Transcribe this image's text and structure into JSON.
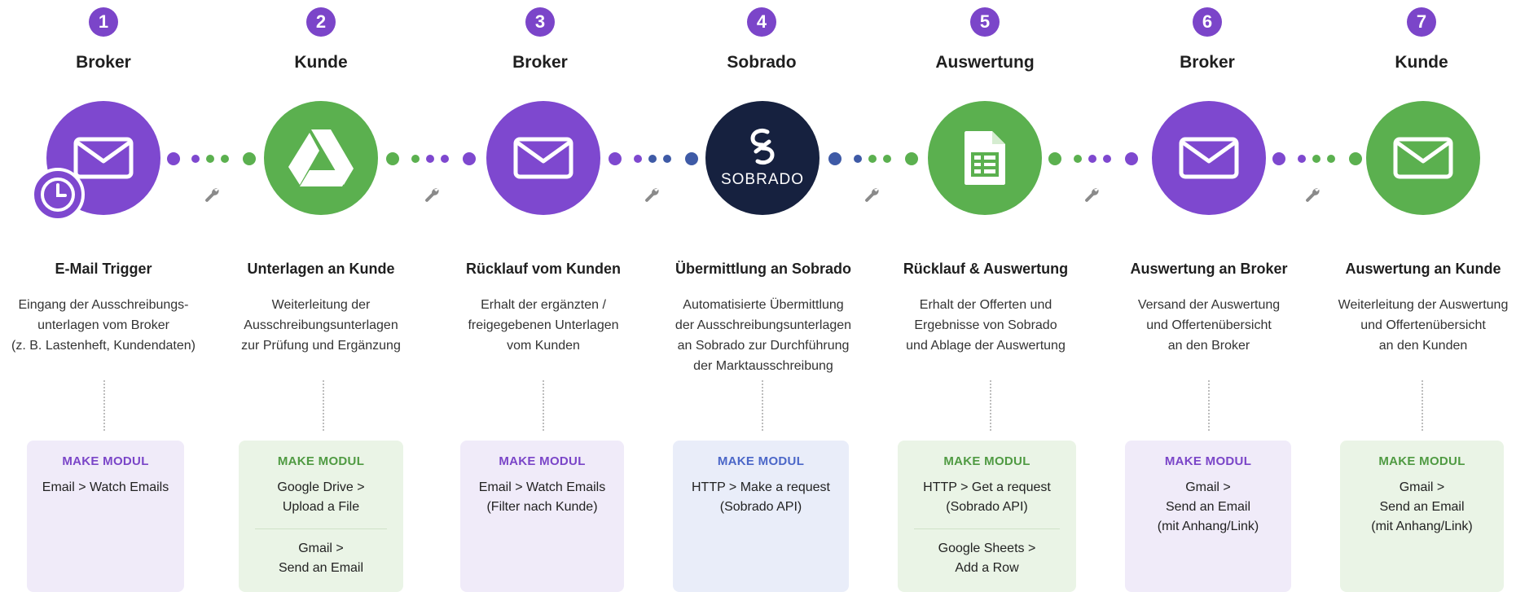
{
  "steps": [
    {
      "number": "1",
      "role": "Broker",
      "icon": "mail-icon",
      "title": "E-Mail Trigger",
      "desc": [
        "Eingang der Ausschreibungs-",
        "unterlagen vom Broker",
        "(z. B. Lastenheft, Kundendaten)"
      ],
      "modul_heading": "MAKE MODUL",
      "modul_items": [
        "Email > Watch Emails"
      ]
    },
    {
      "number": "2",
      "role": "Kunde",
      "icon": "google-drive-icon",
      "title": "Unterlagen an Kunde",
      "desc": [
        "Weiterleitung der",
        "Ausschreibungsunterlagen",
        "zur Prüfung und Ergänzung"
      ],
      "modul_heading": "MAKE MODUL",
      "modul_items": [
        "Google Drive >|Upload a File",
        "Gmail >|Send an Email"
      ]
    },
    {
      "number": "3",
      "role": "Broker",
      "icon": "mail-icon",
      "title": "Rücklauf vom Kunden",
      "desc": [
        "Erhalt der ergänzten /",
        "freigegebenen Unterlagen",
        "vom Kunden"
      ],
      "modul_heading": "MAKE MODUL",
      "modul_items": [
        "Email > Watch Emails|(Filter nach Kunde)"
      ]
    },
    {
      "number": "4",
      "role": "Sobrado",
      "icon": "sobrado-logo-icon",
      "logo_text": "SOBRADO",
      "title": "Übermittlung an Sobrado",
      "desc": [
        "Automatisierte Übermittlung",
        "der Ausschreibungsunterlagen",
        "an Sobrado zur Durchführung",
        "der Marktausschreibung"
      ],
      "modul_heading": "MAKE MODUL",
      "modul_items": [
        "HTTP > Make a request|(Sobrado API)"
      ]
    },
    {
      "number": "5",
      "role": "Auswertung",
      "icon": "google-sheets-icon",
      "title": "Rücklauf & Auswertung",
      "desc": [
        "Erhalt der Offerten und",
        "Ergebnisse von Sobrado",
        "und Ablage der Auswertung"
      ],
      "modul_heading": "MAKE MODUL",
      "modul_items": [
        "HTTP > Get a request|(Sobrado API)",
        "Google Sheets >|Add a Row"
      ]
    },
    {
      "number": "6",
      "role": "Broker",
      "icon": "mail-icon",
      "title": "Auswertung an Broker",
      "desc": [
        "Versand der Auswertung",
        "und Offertenübersicht",
        "an den Broker"
      ],
      "modul_heading": "MAKE MODUL",
      "modul_items": [
        "Gmail >|Send an Email|(mit Anhang/Link)"
      ]
    },
    {
      "number": "7",
      "role": "Kunde",
      "icon": "mail-icon",
      "title": "Auswertung an Kunde",
      "desc": [
        "Weiterleitung der Auswertung",
        "und Offertenübersicht",
        "an den Kunden"
      ],
      "modul_heading": "MAKE MODUL",
      "modul_items": [
        "Gmail >|Send an Email|(mit Anhang/Link)"
      ]
    }
  ],
  "colors": {
    "purple": "#7e48cf",
    "green": "#5bb04f",
    "navy": "#16213f",
    "blue": "#4b67c8"
  }
}
